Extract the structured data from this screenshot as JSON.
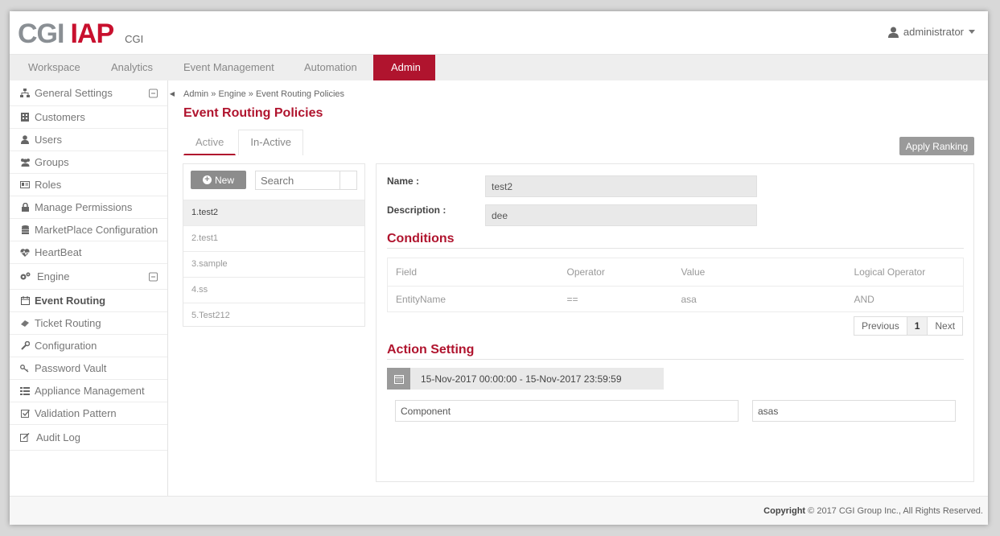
{
  "header": {
    "logo_main": "CGI",
    "logo_accent": "IAP",
    "logo_sub": "CGI",
    "user_name": "administrator"
  },
  "nav": {
    "items": [
      {
        "label": "Workspace"
      },
      {
        "label": "Analytics"
      },
      {
        "label": "Event Management"
      },
      {
        "label": "Automation"
      },
      {
        "label": "Admin"
      }
    ],
    "active": "Admin"
  },
  "sidebar": {
    "items": [
      {
        "label": "General Settings",
        "icon": "sitemap-icon"
      },
      {
        "label": "Customers",
        "icon": "building-icon"
      },
      {
        "label": "Users",
        "icon": "user-icon"
      },
      {
        "label": "Groups",
        "icon": "users-icon"
      },
      {
        "label": "Roles",
        "icon": "id-card-icon"
      },
      {
        "label": "Manage Permissions",
        "icon": "lock-icon"
      },
      {
        "label": "MarketPlace Configuration",
        "icon": "database-icon"
      },
      {
        "label": "HeartBeat",
        "icon": "heartbeat-icon"
      },
      {
        "label": "Engine",
        "icon": "cogs-icon"
      },
      {
        "label": "Event Routing",
        "icon": "calendar-icon"
      },
      {
        "label": "Ticket Routing",
        "icon": "ticket-icon"
      },
      {
        "label": "Configuration",
        "icon": "wrench-icon"
      },
      {
        "label": "Password Vault",
        "icon": "key-icon"
      },
      {
        "label": "Appliance Management",
        "icon": "list-icon"
      },
      {
        "label": "Validation Pattern",
        "icon": "check-square-icon"
      },
      {
        "label": "Audit Log",
        "icon": "edit-icon"
      }
    ]
  },
  "breadcrumb": {
    "items": [
      "Admin",
      "Engine",
      "Event Routing Policies"
    ],
    "separator": "»"
  },
  "page": {
    "title": "Event Routing Policies",
    "tabs": [
      {
        "label": "Active"
      },
      {
        "label": "In-Active"
      }
    ],
    "apply_ranking_label": "Apply Ranking"
  },
  "list": {
    "new_label": "New",
    "search_placeholder": "Search",
    "items": [
      {
        "label": "1.test2"
      },
      {
        "label": "2.test1"
      },
      {
        "label": "3.sample"
      },
      {
        "label": "4.ss"
      },
      {
        "label": "5.Test212"
      }
    ]
  },
  "detail": {
    "name_label": "Name :",
    "name_value": "test2",
    "description_label": "Description :",
    "description_value": "dee",
    "conditions_title": "Conditions",
    "conditions_table": {
      "columns": [
        "Field",
        "Operator",
        "Value",
        "Logical Operator"
      ],
      "rows": [
        [
          "EntityName",
          "==",
          "asa",
          "AND"
        ]
      ]
    },
    "pager": {
      "previous": "Previous",
      "current": "1",
      "next": "Next"
    },
    "action_title": "Action Setting",
    "date_range": "15-Nov-2017 00:00:00 - 15-Nov-2017 23:59:59",
    "component_label": "Component",
    "component_value": "asas"
  },
  "footer": {
    "copyright_bold": "Copyright",
    "copyright_rest": "© 2017 CGI Group Inc., All Rights Reserved."
  },
  "colors": {
    "brand_red": "#b0142e",
    "logo_gray": "#8a8f94",
    "button_gray": "#9a9a9a"
  }
}
